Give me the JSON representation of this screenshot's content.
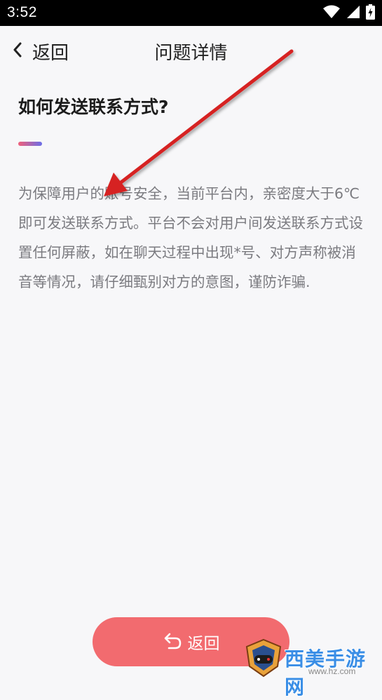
{
  "status_bar": {
    "time": "3:52",
    "icons": [
      "wifi-icon",
      "signal-icon",
      "battery-charging-icon"
    ]
  },
  "nav": {
    "back_label": "返回",
    "title": "问题详情"
  },
  "question": {
    "title": "如何发送联系方式?",
    "answer": "为保障用户的账号安全，当前平台内，亲密度大于6℃即可发送联系方式。平台不会对用户间发送联系方式设置任何屏蔽，如在聊天过程中出现*号、对方声称被消音等情况，请仔细甄别对方的意图，谨防诈骗."
  },
  "bottom_button": {
    "label": "返回",
    "icon": "return-arrow-icon"
  },
  "watermark": {
    "text": "西美手游网",
    "sub": "www.hz.com"
  },
  "colors": {
    "accent_button": "#f26b6f",
    "annotation_arrow": "#d62020",
    "accent_bar_start": "#f0607a",
    "accent_bar_end": "#6b6ee8"
  }
}
